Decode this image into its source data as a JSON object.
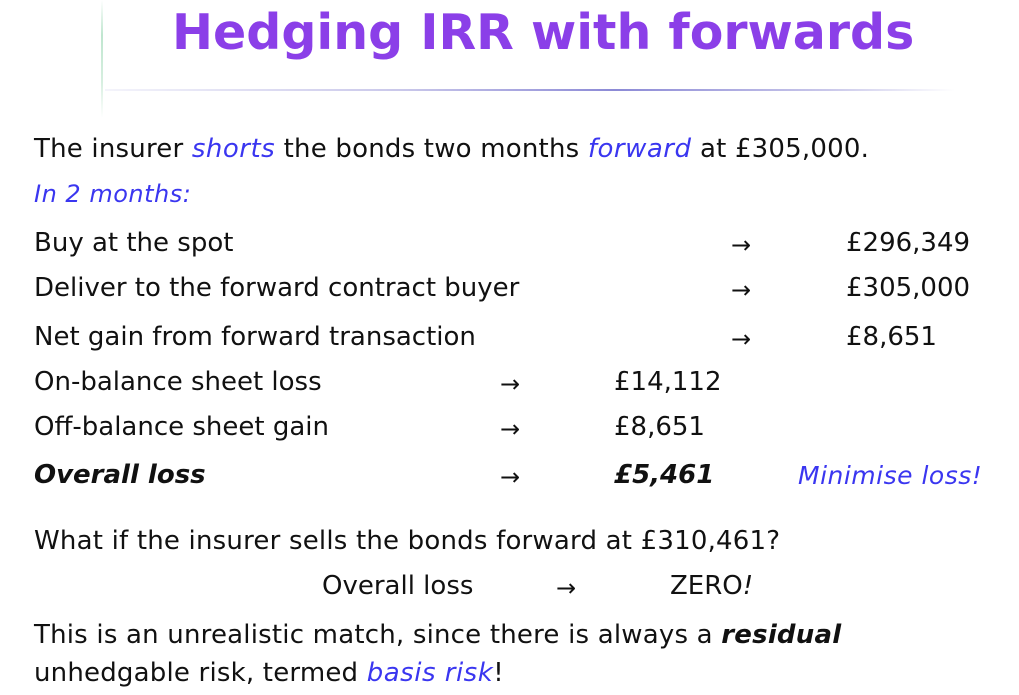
{
  "slide": {
    "title": "Hedging IRR with forwards",
    "intro": {
      "part1": "The insurer ",
      "shorts": "shorts",
      "part2": " the bonds two months ",
      "forward": "forward",
      "part3": " at £305,000."
    },
    "subhead": "In 2 months:",
    "rows": [
      {
        "label": "Buy at the spot",
        "arrow": "→",
        "value": "£296,349"
      },
      {
        "label": "Deliver to the forward contract buyer",
        "arrow": "→",
        "value": "£305,000"
      },
      {
        "label": "Net gain from forward transaction",
        "arrow": "→",
        "value": "£8,651"
      },
      {
        "label": "On-balance sheet loss",
        "arrow": "→",
        "value": "£14,112"
      },
      {
        "label": "Off-balance sheet gain",
        "arrow": "→",
        "value": "£8,651"
      },
      {
        "label": "Overall loss",
        "arrow": "→",
        "value": "£5,461",
        "note": "Minimise loss!"
      }
    ],
    "question": "What if the insurer sells the bonds forward at £310,461?",
    "zero_row": {
      "label": "Overall loss",
      "arrow": "→",
      "value": "ZERO",
      "excl": "!"
    },
    "closing": {
      "part1": "This is an unrealistic match, since there is always a ",
      "residual": "residual",
      "part2": "unhedgable risk, termed ",
      "basis_risk": "basis risk",
      "excl": "!"
    }
  }
}
